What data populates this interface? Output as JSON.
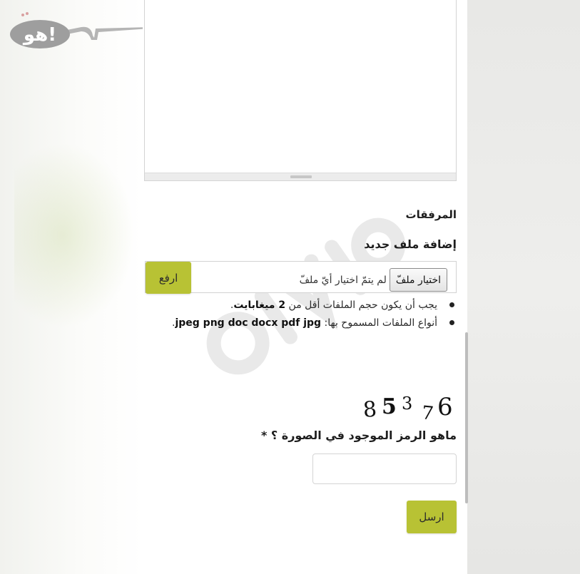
{
  "logo": {
    "text": "هو!"
  },
  "attachments": {
    "section_title": "المرفقات",
    "add_file_title": "إضافة ملف جديد",
    "choose_file_label": "اختيار ملفّ",
    "no_file_text": "لم يتمّ اختيار أيّ ملفّ",
    "upload_label": "ارفع"
  },
  "rules": {
    "size_prefix": "يجب أن يكون حجم الملفات أقل من ",
    "size_value": "2 ميغابايت",
    "size_suffix": ".",
    "types_prefix": "أنواع الملفات المسموح بها: ",
    "types_value": "jpeg png doc docx pdf jpg",
    "types_suffix": "."
  },
  "captcha": {
    "digits": [
      "8",
      "5",
      "3",
      "7",
      "6"
    ],
    "question": "ماهو الرمز الموجود في الصورة ؟ *",
    "input_value": ""
  },
  "submit": {
    "label": "ارسل"
  },
  "colors": {
    "accent_green": "#b8c234",
    "logo_bubble": "#9e9e9e"
  }
}
